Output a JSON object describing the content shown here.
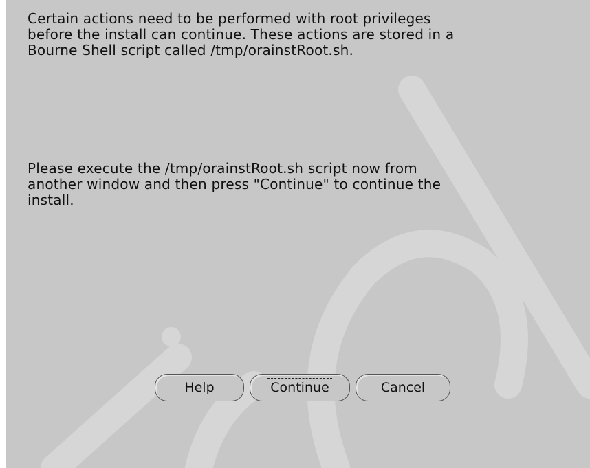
{
  "dialog": {
    "message_1": "Certain actions need to be performed with root privileges\nbefore the install can continue. These actions are stored in a\nBourne Shell script called /tmp/orainstRoot.sh.",
    "message_2": "Please execute the /tmp/orainstRoot.sh script now from\nanother window and then press \"Continue\" to continue the\ninstall.",
    "buttons": {
      "help": "Help",
      "continue": "Continue",
      "cancel": "Cancel"
    },
    "background_color": "#c7c7c7"
  }
}
